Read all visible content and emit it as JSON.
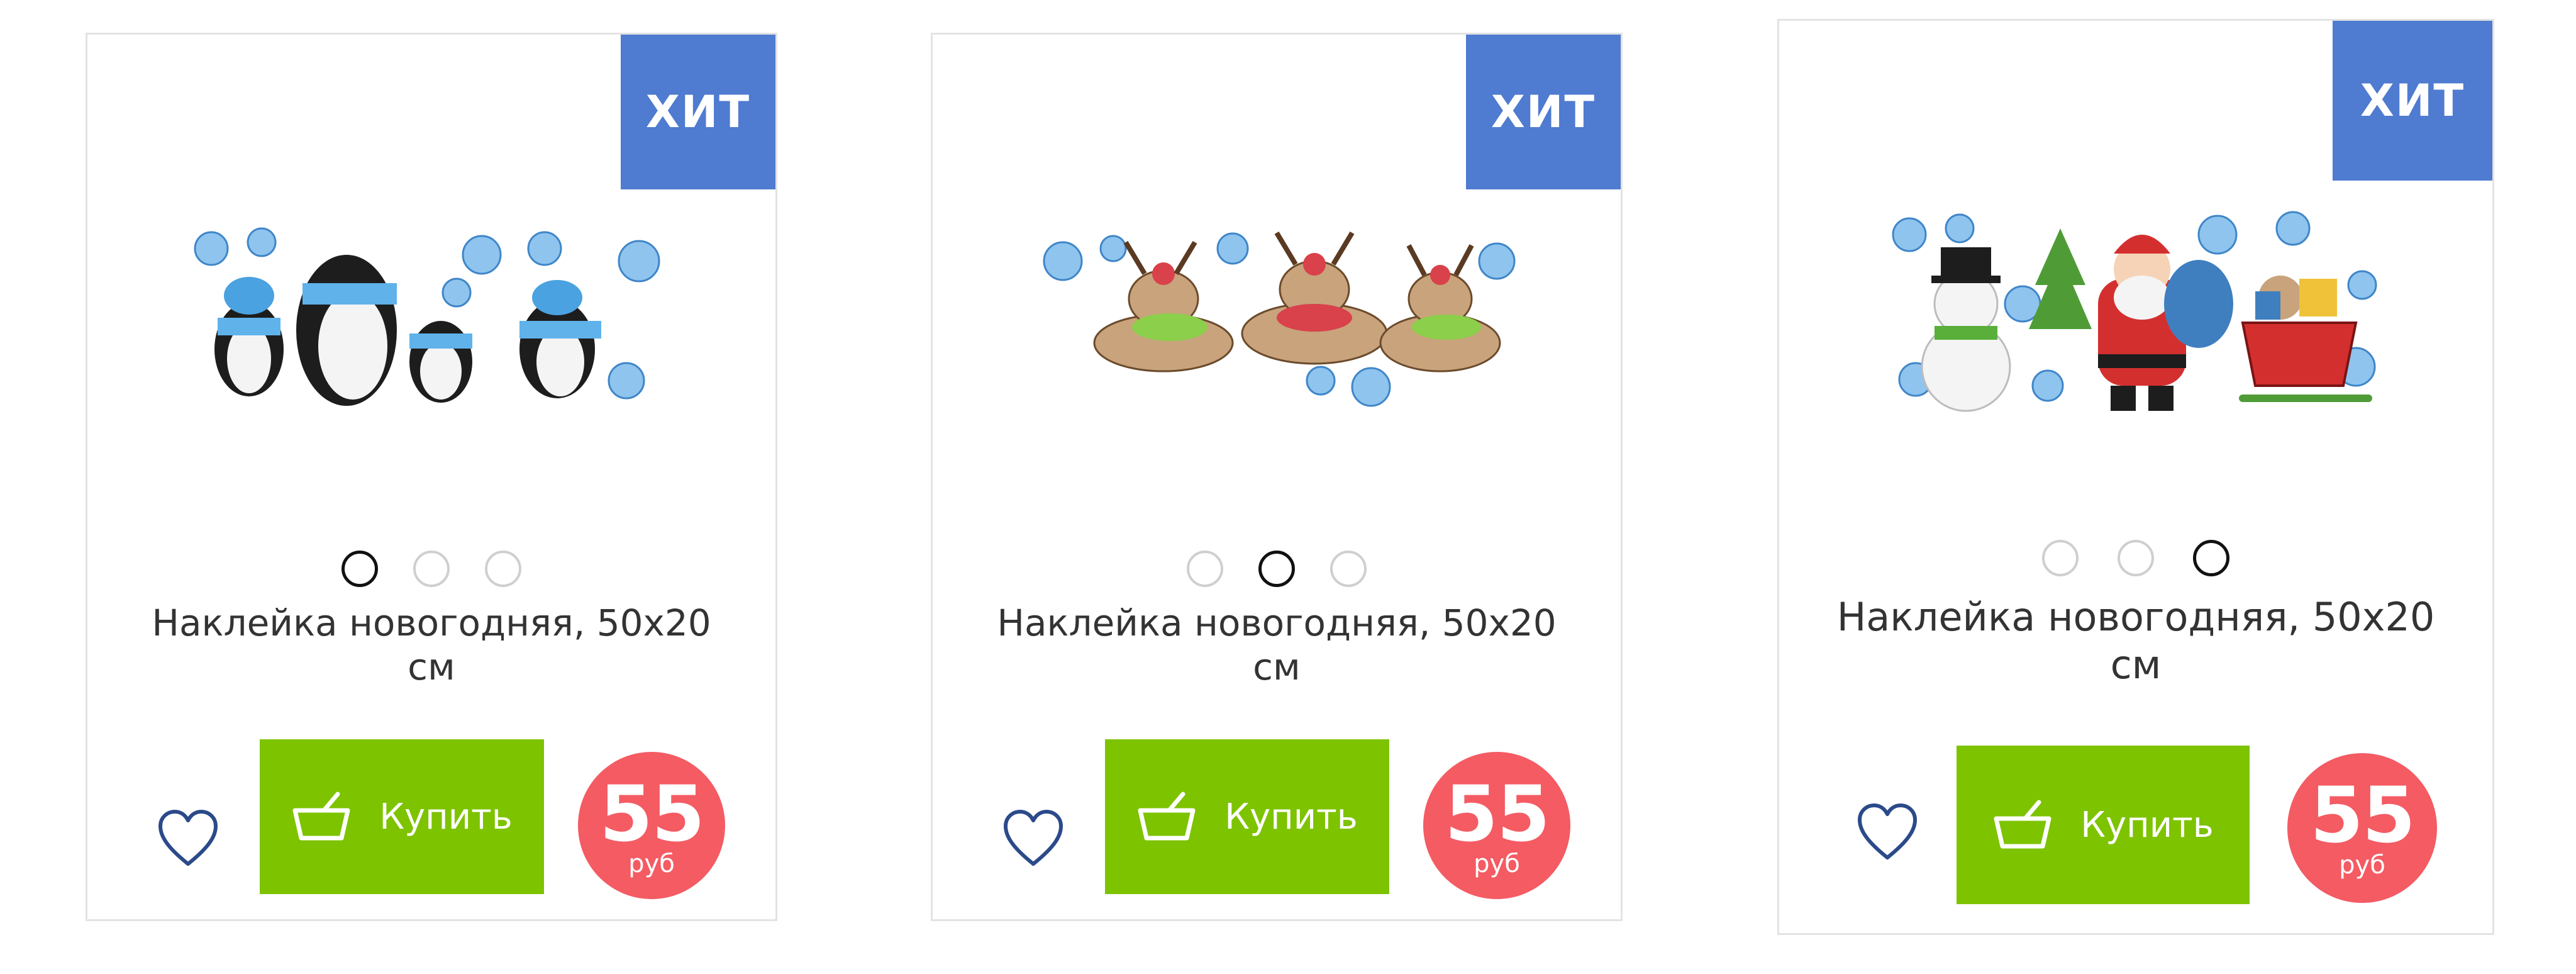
{
  "colors": {
    "badge": "#4f7bd0",
    "buy": "#7dc300",
    "price": "#f45b63",
    "heart": "#2b4a8a",
    "dot_active": "#111111",
    "dot_inactive": "#cfcfcf"
  },
  "products": [
    {
      "badge": "ХИТ",
      "title": "Наклейка новогодняя, 50х20 см",
      "image_icon": "penguins-sticker-image",
      "slider": {
        "active_index": 0,
        "count": 3
      },
      "buy_label": "Купить",
      "price": {
        "value": "55",
        "currency": "руб"
      }
    },
    {
      "badge": "ХИТ",
      "title": "Наклейка новогодняя, 50х20 см",
      "image_icon": "reindeer-sticker-image",
      "slider": {
        "active_index": 1,
        "count": 3
      },
      "buy_label": "Купить",
      "price": {
        "value": "55",
        "currency": "руб"
      }
    },
    {
      "badge": "ХИТ",
      "title": "Наклейка новогодняя, 50х20 см",
      "image_icon": "snowman-santa-sleigh-sticker-image",
      "slider": {
        "active_index": 2,
        "count": 3
      },
      "buy_label": "Купить",
      "price": {
        "value": "55",
        "currency": "руб"
      }
    }
  ]
}
